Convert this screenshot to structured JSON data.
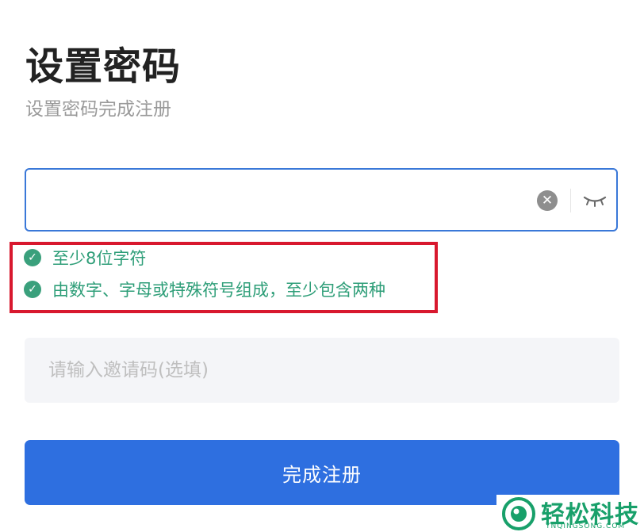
{
  "header": {
    "title": "设置密码",
    "subtitle": "设置密码完成注册"
  },
  "password_field": {
    "value": "",
    "clear_icon": "clear-circle-icon",
    "visibility_icon": "eye-closed-icon"
  },
  "rules": [
    {
      "icon": "check-circle-icon",
      "text": "至少8位字符",
      "status": "passed"
    },
    {
      "icon": "check-circle-icon",
      "text": "由数字、字母或特殊符号组成，至少包含两种",
      "status": "passed"
    }
  ],
  "invite_field": {
    "placeholder": "请输入邀请码(选填)",
    "value": ""
  },
  "submit": {
    "label": "完成注册"
  },
  "watermark": {
    "brand": "轻松科技",
    "domain": "YNQINGSONG.COM"
  },
  "colors": {
    "accent": "#2e6fe0",
    "focus_border": "#3a78d8",
    "success": "#2e9e78",
    "highlight": "#d8182e"
  }
}
